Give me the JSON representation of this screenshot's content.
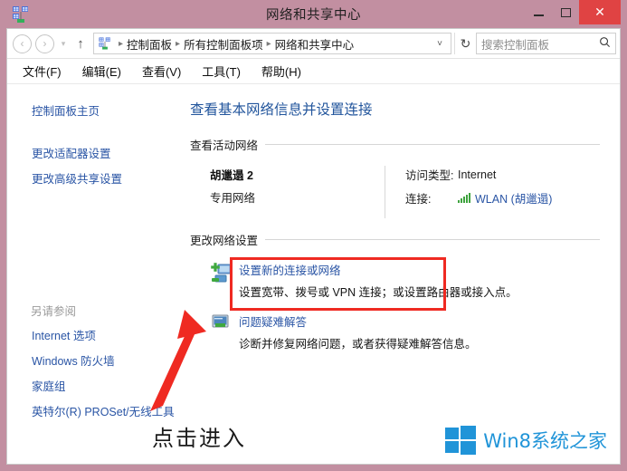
{
  "window": {
    "title": "网络和共享中心",
    "icon": "network-sharing-icon",
    "minimize_label": "最小化",
    "maximize_label": "最大化",
    "close_label": "✕",
    "frame_color": "#c28fa1",
    "close_button_color": "#e04343"
  },
  "navbar": {
    "back_label": "‹",
    "forward_label": "›",
    "recent_label": "▾",
    "up_label": "↑",
    "breadcrumb": [
      "控制面板",
      "所有控制面板项",
      "网络和共享中心"
    ],
    "breadcrumb_dropdown": "˅",
    "refresh_label": "↻"
  },
  "search": {
    "placeholder": "搜索控制面板",
    "icon": "search-icon"
  },
  "menubar": {
    "items": [
      "文件(F)",
      "编辑(E)",
      "查看(V)",
      "工具(T)",
      "帮助(H)"
    ]
  },
  "sidebar": {
    "home_link": "控制面板主页",
    "links": [
      "更改适配器设置",
      "更改高级共享设置"
    ],
    "see_also_heading": "另请参阅",
    "see_also_links": [
      "Internet 选项",
      "Windows 防火墙",
      "家庭组",
      "英特尔(R) PROSet/无线工具"
    ]
  },
  "main": {
    "page_title": "查看基本网络信息并设置连接",
    "active_networks": {
      "heading": "查看活动网络",
      "network_name": "胡邋遢 2",
      "network_type": "专用网络",
      "access_type_label": "访问类型:",
      "access_type_value": "Internet",
      "connection_label": "连接:",
      "connection_value": "WLAN (胡邋遢)",
      "signal_icon": "wifi-signal-icon"
    },
    "change_settings": {
      "heading": "更改网络设置",
      "items": [
        {
          "icon": "new-connection-icon",
          "title": "设置新的连接或网络",
          "description": "设置宽带、拨号或 VPN 连接；或设置路由器或接入点。",
          "highlighted": true
        },
        {
          "icon": "troubleshoot-icon",
          "title": "问题疑难解答",
          "description": "诊断并修复网络问题，或者获得疑难解答信息。",
          "highlighted": false
        }
      ]
    }
  },
  "annotation": {
    "callout_text": "点击进入",
    "highlight_color": "#ef2a22",
    "arrow_color": "#ef2a22"
  },
  "watermark": {
    "text": "Win8系统之家",
    "color": "#2094d8",
    "logo": "windows-logo-icon"
  }
}
